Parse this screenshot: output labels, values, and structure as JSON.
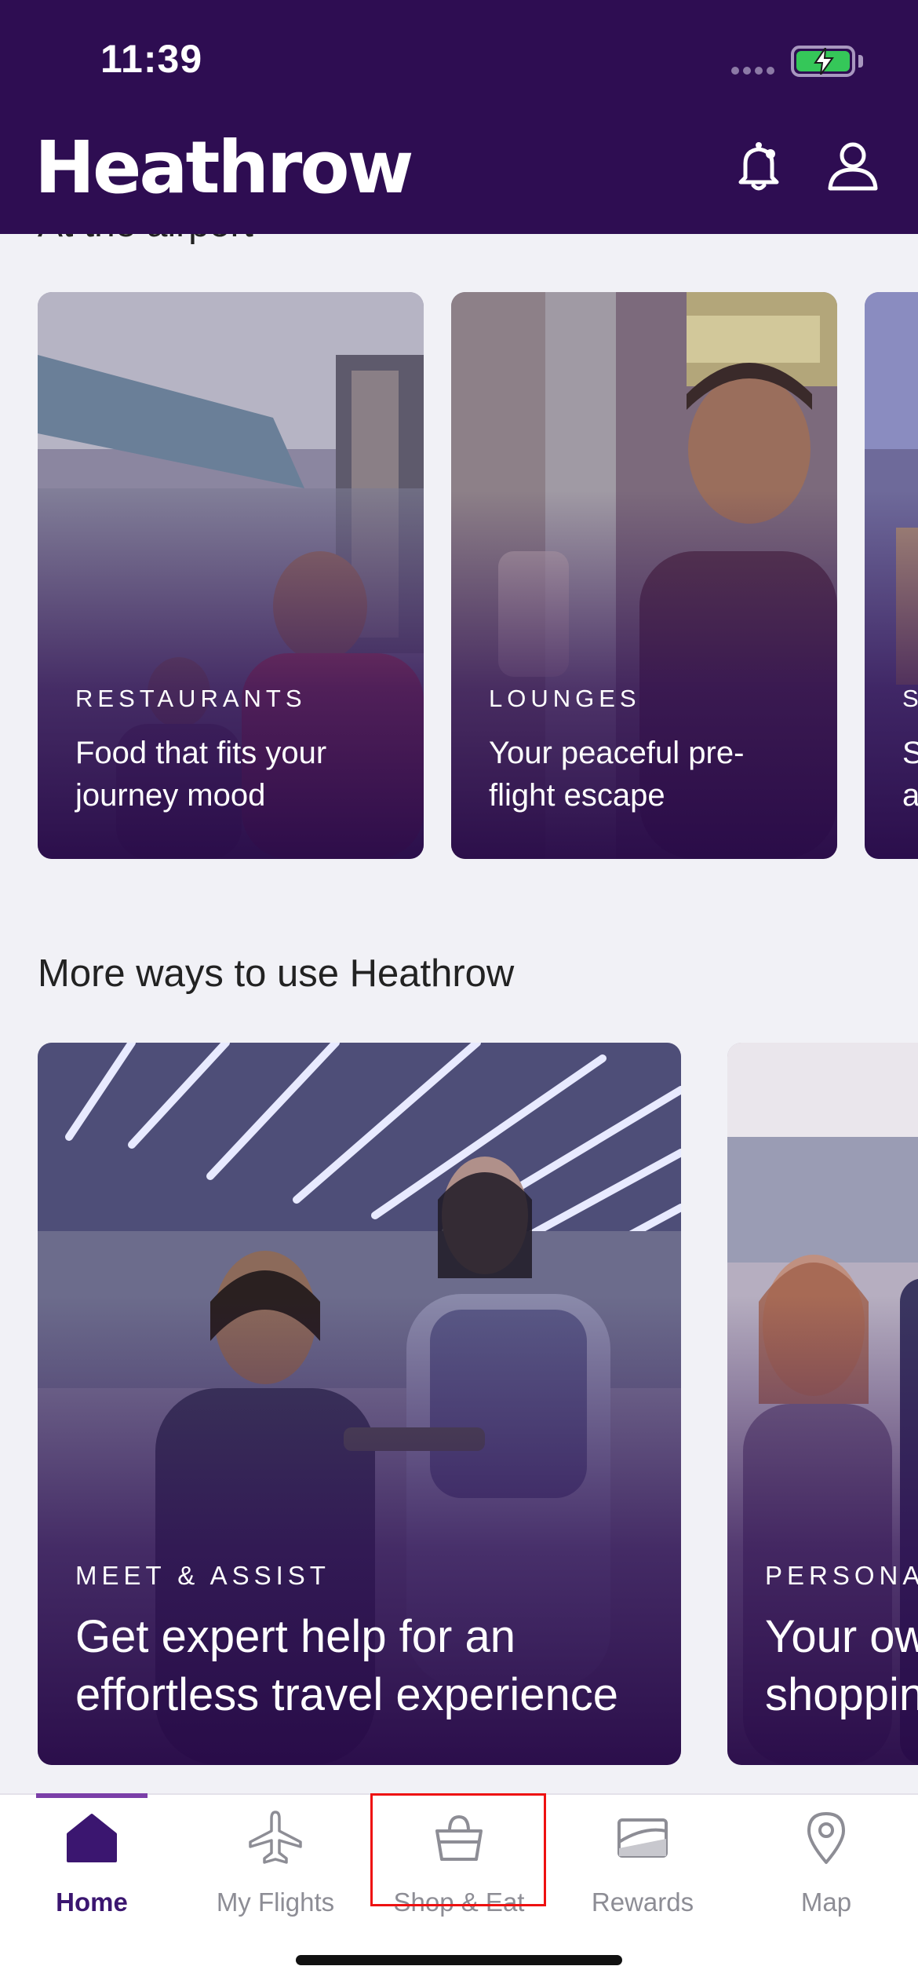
{
  "status_bar": {
    "time": "11:39"
  },
  "header": {
    "logo": "Heathrow"
  },
  "at_airport": {
    "heading_peek": "At the airport",
    "cards": [
      {
        "eyebrow": "RESTAURANTS",
        "line1": "Food that fits your",
        "line2": "journey mood"
      },
      {
        "eyebrow": "LOUNGES",
        "line1": "Your peaceful pre-",
        "line2": "flight escape"
      },
      {
        "eyebrow": "S",
        "line1": "S",
        "line2": "a"
      }
    ]
  },
  "more_ways": {
    "title": "More ways to use Heathrow",
    "cards": [
      {
        "eyebrow": "MEET & ASSIST",
        "line1": "Get expert help for an",
        "line2": "effortless travel experience"
      },
      {
        "eyebrow": "PERSONAL",
        "line1": "Your ow",
        "line2": "shoppin"
      }
    ]
  },
  "tabbar": {
    "tabs": [
      {
        "label": "Home",
        "icon": "home-icon",
        "active": true
      },
      {
        "label": "My Flights",
        "icon": "airplane-icon"
      },
      {
        "label": "Shop & Eat",
        "icon": "shopping-basket-icon"
      },
      {
        "label": "Rewards",
        "icon": "rewards-card-icon"
      },
      {
        "label": "Map",
        "icon": "map-pin-icon"
      }
    ]
  },
  "colors": {
    "brand_purple": "#2e0d52",
    "active_tab": "#3b1670",
    "tab_indicator": "#7b3fa8",
    "highlight_box": "#ee1111"
  }
}
